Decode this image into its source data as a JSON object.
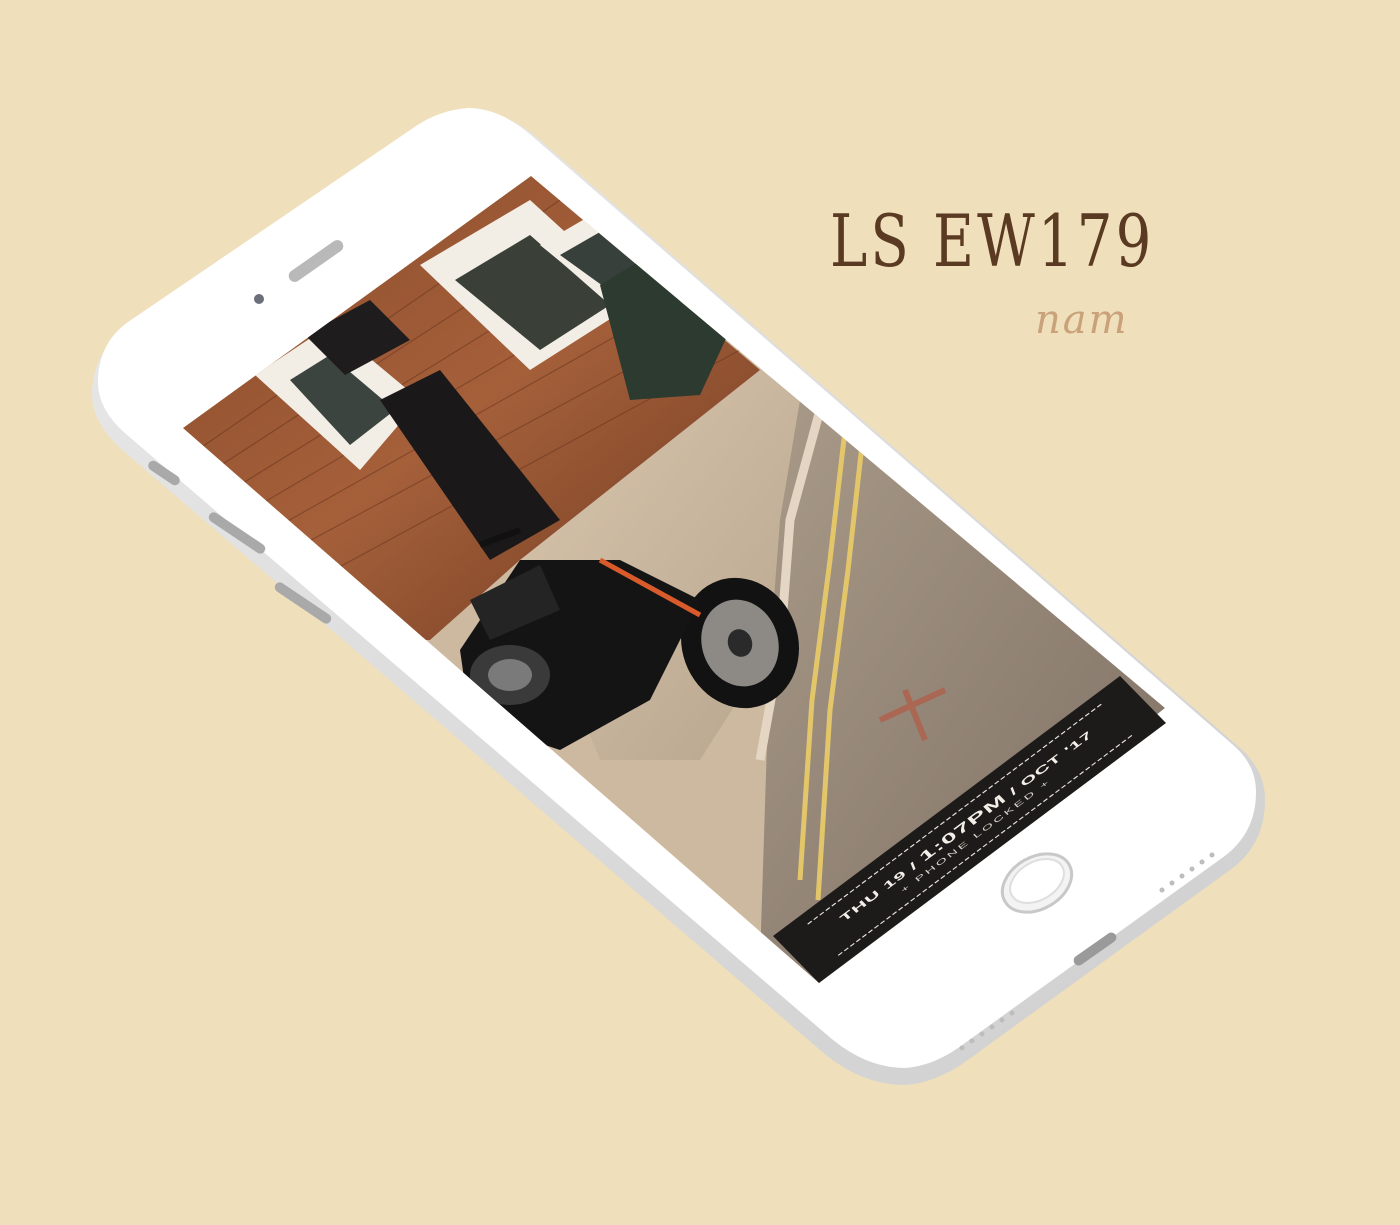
{
  "branding": {
    "title": "LS EW179",
    "author": "nam"
  },
  "lockscreen": {
    "day": "THU 19",
    "separator": "/",
    "time": "1:07PM",
    "date": "OCT '17",
    "status": "+ PHONE LOCKED +"
  },
  "colors": {
    "background": "#efdfbb",
    "title": "#5a3a22",
    "subtitle": "#c9a27a",
    "phone_body": "#ffffff",
    "lock_bar": "#1d1b1a"
  },
  "icons": {
    "camera": "front-camera-icon",
    "speaker": "earpiece-speaker-icon",
    "home": "home-button-icon"
  }
}
